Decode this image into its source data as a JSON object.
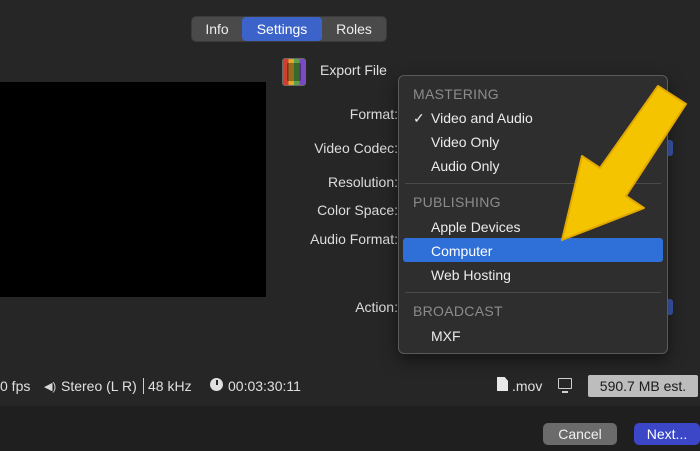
{
  "tabs": [
    {
      "label": "Info"
    },
    {
      "label": "Settings",
      "selected": true
    },
    {
      "label": "Roles"
    }
  ],
  "export": {
    "label": "Export File"
  },
  "fields": {
    "format": "Format:",
    "video_codec": "Video Codec:",
    "resolution": "Resolution:",
    "color_space": "Color Space:",
    "audio_format": "Audio Format:",
    "action": "Action:"
  },
  "menu": {
    "mastering": {
      "header": "MASTERING",
      "items": [
        "Video and Audio",
        "Video Only",
        "Audio Only"
      ],
      "check": "✓"
    },
    "publishing": {
      "header": "PUBLISHING",
      "items": [
        "Apple Devices",
        "Computer",
        "Web Hosting"
      ]
    },
    "broadcast": {
      "header": "BROADCAST",
      "items": [
        "MXF"
      ]
    },
    "selected_item": "Computer"
  },
  "status": {
    "fps": "0 fps",
    "audio": "Stereo (L R)",
    "sample_rate": "48 kHz",
    "duration": "00:03:30:11",
    "file_ext": ".mov",
    "size": "590.7 MB est."
  },
  "buttons": {
    "cancel": "Cancel",
    "next": "Next..."
  },
  "colors": {
    "accent": "#3b63c9",
    "highlight": "#2f6fd8",
    "arrow": "#f5c400"
  },
  "icons": {
    "speaker": "speaker-icon",
    "clock": "clock-icon",
    "file": "file-icon",
    "monitor": "monitor-icon"
  }
}
